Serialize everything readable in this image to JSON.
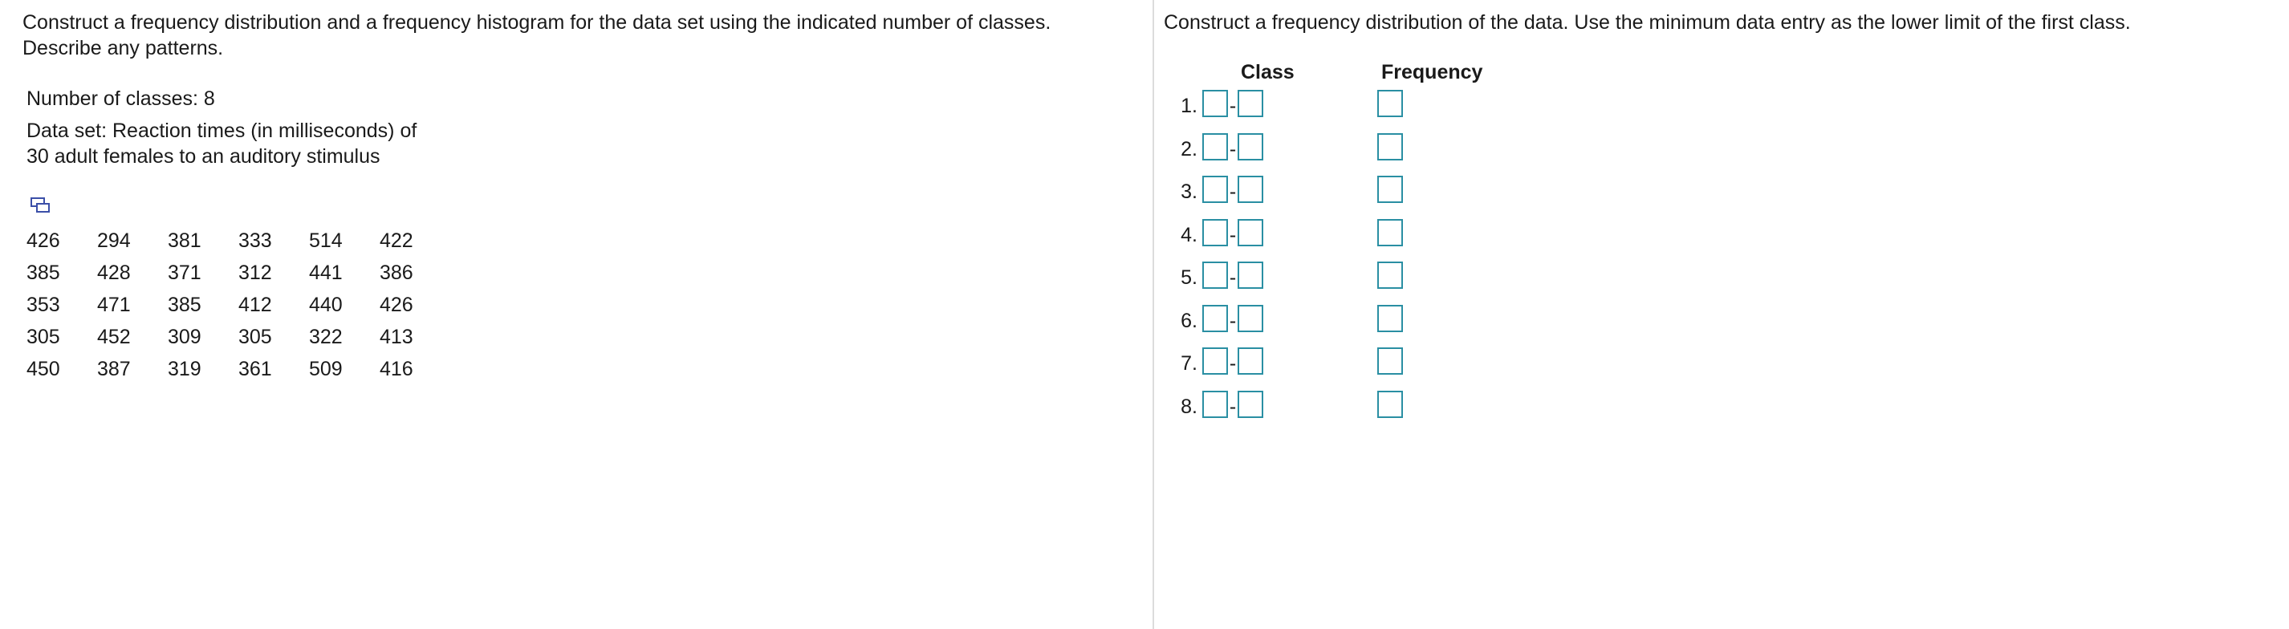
{
  "left": {
    "instructions": "Construct a frequency distribution and a frequency histogram for the data set using the indicated number of classes. Describe any patterns.",
    "number_of_classes": "Number of classes: 8",
    "dataset_line1": "Data set: Reaction times (in milliseconds) of",
    "dataset_line2": "30 adult females to an auditory stimulus",
    "copy_icon": "copy-data-icon",
    "data_rows": [
      [
        "426",
        "294",
        "381",
        "333",
        "514",
        "422"
      ],
      [
        "385",
        "428",
        "371",
        "312",
        "441",
        "386"
      ],
      [
        "353",
        "471",
        "385",
        "412",
        "440",
        "426"
      ],
      [
        "305",
        "452",
        "309",
        "305",
        "322",
        "413"
      ],
      [
        "450",
        "387",
        "319",
        "361",
        "509",
        "416"
      ]
    ]
  },
  "right": {
    "instructions": "Construct a frequency distribution of the data. Use the minimum data entry as the lower limit of the first class.",
    "header_class": "Class",
    "header_frequency": "Frequency",
    "rows": [
      {
        "num": "1.",
        "dash": "-",
        "low": "",
        "high": "",
        "freq": ""
      },
      {
        "num": "2.",
        "dash": "-",
        "low": "",
        "high": "",
        "freq": ""
      },
      {
        "num": "3.",
        "dash": "-",
        "low": "",
        "high": "",
        "freq": ""
      },
      {
        "num": "4.",
        "dash": "-",
        "low": "",
        "high": "",
        "freq": ""
      },
      {
        "num": "5.",
        "dash": "-",
        "low": "",
        "high": "",
        "freq": ""
      },
      {
        "num": "6.",
        "dash": "-",
        "low": "",
        "high": "",
        "freq": ""
      },
      {
        "num": "7.",
        "dash": "-",
        "low": "",
        "high": "",
        "freq": ""
      },
      {
        "num": "8.",
        "dash": "-",
        "low": "",
        "high": "",
        "freq": ""
      }
    ]
  },
  "colors": {
    "input_border": "#2a8fa3",
    "divider": "#dcdcdc",
    "copy_icon": "#3b4fa8"
  }
}
